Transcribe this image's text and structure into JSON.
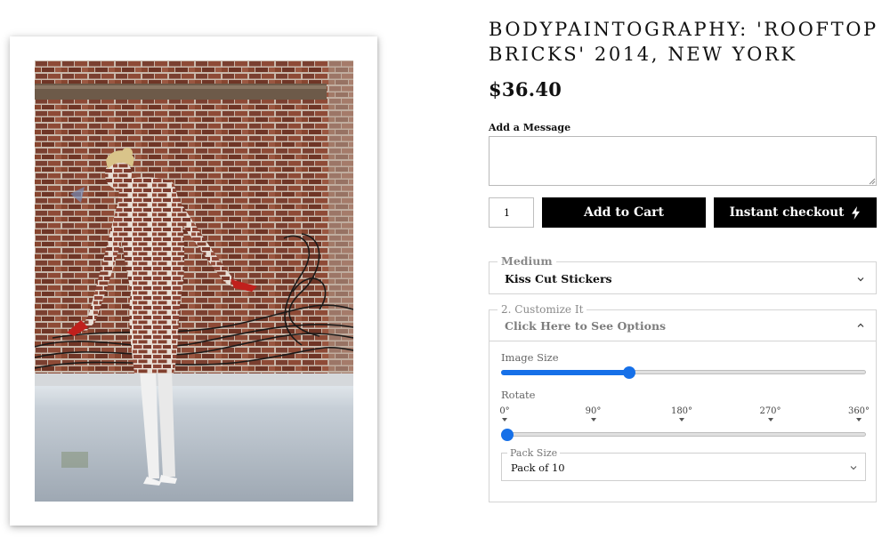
{
  "product": {
    "title": "BODYPAINTOGRAPHY: 'ROOFTOP BRICKS' 2014, NEW YORK",
    "price": "$36.40",
    "image_alt": "Woman body-painted with a brick pattern standing in front of a brick wall on a rooftop"
  },
  "message": {
    "label": "Add a Message",
    "value": ""
  },
  "cart": {
    "quantity": "1",
    "add_to_cart_label": "Add to Cart",
    "instant_checkout_label": "Instant checkout",
    "instant_checkout_icon": "lightning-bolt-icon"
  },
  "medium": {
    "legend": "Medium",
    "selected": "Kiss Cut Stickers",
    "icon": "chevron-down-icon"
  },
  "customize": {
    "legend": "2. Customize It",
    "toggle_label": "Click Here to See Options",
    "icon": "chevron-up-icon",
    "image_size": {
      "label": "Image Size",
      "value_fraction": 0.35
    },
    "rotate": {
      "label": "Rotate",
      "ticks": [
        "0°",
        "90°",
        "180°",
        "270°",
        "360°"
      ],
      "value_degrees": 0
    },
    "pack_size": {
      "legend": "Pack Size",
      "selected": "Pack of 10",
      "icon": "chevron-down-icon"
    }
  },
  "colors": {
    "accent": "#1670e8",
    "button_bg": "#000000",
    "button_text": "#ffffff"
  }
}
